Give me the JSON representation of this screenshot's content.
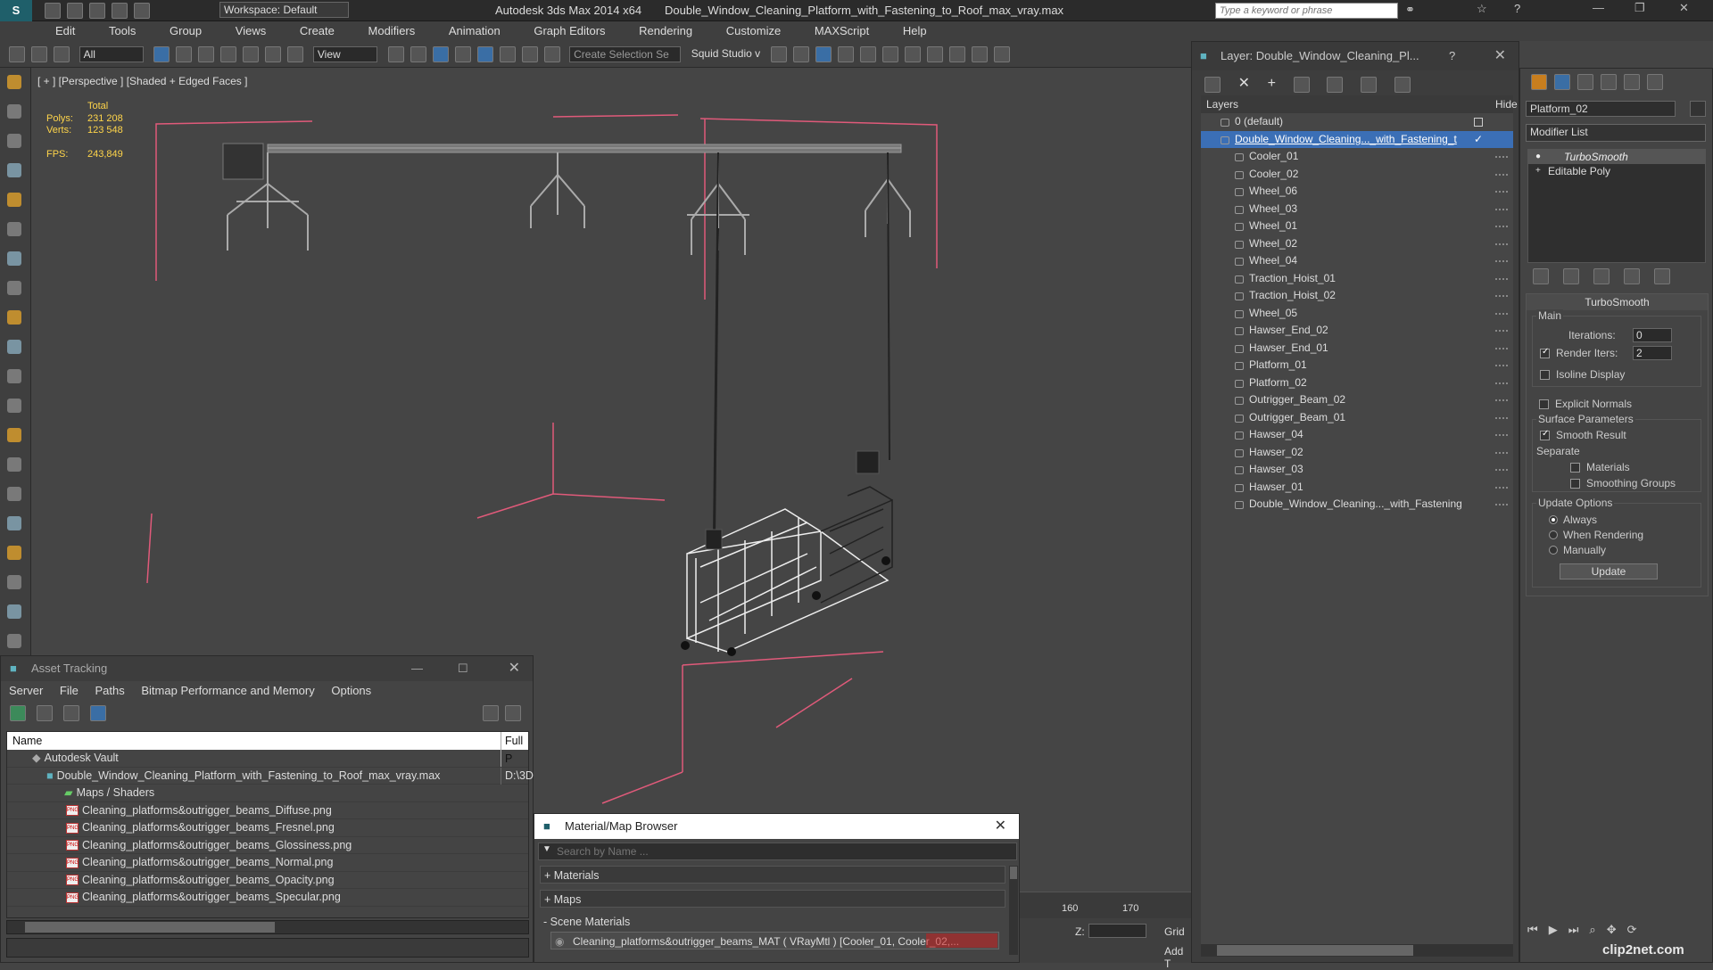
{
  "titlebar": {
    "app_title": "Autodesk 3ds Max  2014 x64",
    "file_title": "Double_Window_Cleaning_Platform_with_Fastening_to_Roof_max_vray.max",
    "workspace": "Workspace: Default",
    "search_placeholder": "Type a keyword or phrase"
  },
  "menu": [
    "Edit",
    "Tools",
    "Group",
    "Views",
    "Create",
    "Modifiers",
    "Animation",
    "Graph Editors",
    "Rendering",
    "Customize",
    "MAXScript",
    "Help"
  ],
  "toolbar": {
    "filter": "All",
    "ref_coord": "View",
    "selection_set": "Create Selection Se",
    "studio": "Squid Studio v"
  },
  "viewport": {
    "label": "[ + ] [Perspective ] [Shaded + Edged Faces ]",
    "stats_header": "Total",
    "polys_label": "Polys:",
    "polys_value": "231 208",
    "verts_label": "Verts:",
    "verts_value": "123 548",
    "fps_label": "FPS:",
    "fps_value": "243,849"
  },
  "layer_panel": {
    "title": "Layer: Double_Window_Cleaning_Pl...",
    "help": "?",
    "header_layers": "Layers",
    "header_hide": "Hide",
    "default_layer": "0 (default)",
    "active_layer": "Double_Window_Cleaning..._with_Fastening_t",
    "items": [
      "Cooler_01",
      "Cooler_02",
      "Wheel_06",
      "Wheel_03",
      "Wheel_01",
      "Wheel_02",
      "Wheel_04",
      "Traction_Hoist_01",
      "Traction_Hoist_02",
      "Wheel_05",
      "Hawser_End_02",
      "Hawser_End_01",
      "Platform_01",
      "Platform_02",
      "Outrigger_Beam_02",
      "Outrigger_Beam_01",
      "Hawser_04",
      "Hawser_02",
      "Hawser_03",
      "Hawser_01",
      "Double_Window_Cleaning..._with_Fastening"
    ]
  },
  "command_panel": {
    "object_name": "Platform_02",
    "modifier_list": "Modifier List",
    "stack": [
      "TurboSmooth",
      "Editable Poly"
    ],
    "rollout_title": "TurboSmooth",
    "main": "Main",
    "iterations_label": "Iterations:",
    "iterations_value": "0",
    "render_iters_label": "Render Iters:",
    "render_iters_value": "2",
    "isoline": "Isoline Display",
    "explicit_normals": "Explicit Normals",
    "surface_params": "Surface Parameters",
    "smooth_result": "Smooth Result",
    "separate": "Separate",
    "materials": "Materials",
    "smoothing_groups": "Smoothing Groups",
    "update_options": "Update Options",
    "always": "Always",
    "when_rendering": "When Rendering",
    "manually": "Manually",
    "update_button": "Update"
  },
  "asset_tracking": {
    "title": "Asset Tracking",
    "menu": [
      "Server",
      "File",
      "Paths",
      "Bitmap Performance and Memory",
      "Options"
    ],
    "col_name": "Name",
    "col_path": "Full P",
    "vault": "Autodesk Vault",
    "file": "Double_Window_Cleaning_Platform_with_Fastening_to_Roof_max_vray.max",
    "file_path": "D:\\3D",
    "maps_folder": "Maps / Shaders",
    "maps": [
      "Cleaning_platforms&outrigger_beams_Diffuse.png",
      "Cleaning_platforms&outrigger_beams_Fresnel.png",
      "Cleaning_platforms&outrigger_beams_Glossiness.png",
      "Cleaning_platforms&outrigger_beams_Normal.png",
      "Cleaning_platforms&outrigger_beams_Opacity.png",
      "Cleaning_platforms&outrigger_beams_Specular.png"
    ]
  },
  "material_browser": {
    "title": "Material/Map Browser",
    "search_placeholder": "Search by Name ...",
    "groups": [
      "+ Materials",
      "+ Maps",
      "- Scene Materials"
    ],
    "scene_material": "Cleaning_platforms&outrigger_beams_MAT ( VRayMtl ) [Cooler_01, Cooler_02,..."
  },
  "timeline": {
    "ticks": [
      "160",
      "170"
    ],
    "z_label": "Z:",
    "grid_label": "Grid",
    "add_label": "Add T"
  },
  "watermark": "clip2net.com"
}
